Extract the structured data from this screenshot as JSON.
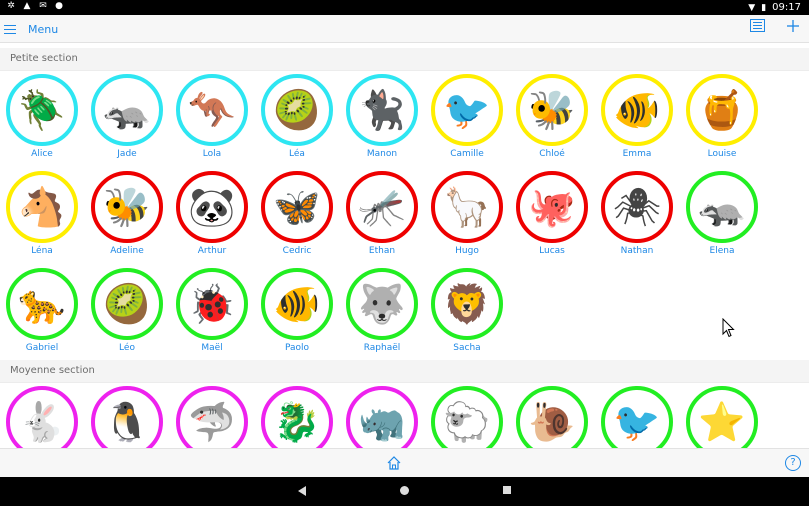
{
  "statusbar": {
    "time": "09:17",
    "left_icons": [
      "settings-icon",
      "drive-icon",
      "mail-icon",
      "record-icon"
    ]
  },
  "toolbar": {
    "menu_label": "Menu"
  },
  "colors": {
    "accent": "#1e88e5",
    "cyan": "#2ee6f2",
    "yellow": "#ffee00",
    "red": "#ee0000",
    "green": "#22ee22",
    "magenta": "#ee22ee"
  },
  "sections": [
    {
      "title": "Petite section",
      "children": [
        {
          "name": "Alice",
          "ring": "#2ee6f2",
          "emoji": "🪲"
        },
        {
          "name": "Jade",
          "ring": "#2ee6f2",
          "emoji": "🦡"
        },
        {
          "name": "Lola",
          "ring": "#2ee6f2",
          "emoji": "🦘"
        },
        {
          "name": "Léa",
          "ring": "#2ee6f2",
          "emoji": "🥝"
        },
        {
          "name": "Manon",
          "ring": "#2ee6f2",
          "emoji": "🐈‍⬛"
        },
        {
          "name": "Camille",
          "ring": "#ffee00",
          "emoji": "🐦"
        },
        {
          "name": "Chloé",
          "ring": "#ffee00",
          "emoji": "🐝"
        },
        {
          "name": "Emma",
          "ring": "#ffee00",
          "emoji": "🐠"
        },
        {
          "name": "Louise",
          "ring": "#ffee00",
          "emoji": "🍯"
        },
        {
          "name": "Léna",
          "ring": "#ffee00",
          "emoji": "🐴"
        },
        {
          "name": "Adeline",
          "ring": "#ee0000",
          "emoji": "🐝"
        },
        {
          "name": "Arthur",
          "ring": "#ee0000",
          "emoji": "🐼"
        },
        {
          "name": "Cedric",
          "ring": "#ee0000",
          "emoji": "🦋"
        },
        {
          "name": "Ethan",
          "ring": "#ee0000",
          "emoji": "🦟"
        },
        {
          "name": "Hugo",
          "ring": "#ee0000",
          "emoji": "🦙"
        },
        {
          "name": "Lucas",
          "ring": "#ee0000",
          "emoji": "🐙"
        },
        {
          "name": "Nathan",
          "ring": "#ee0000",
          "emoji": "🕷"
        },
        {
          "name": "Elena",
          "ring": "#22ee22",
          "emoji": "🦡"
        },
        {
          "name": "Gabriel",
          "ring": "#22ee22",
          "emoji": "🐆"
        },
        {
          "name": "Léo",
          "ring": "#22ee22",
          "emoji": "🥝"
        },
        {
          "name": "Maël",
          "ring": "#22ee22",
          "emoji": "🐞"
        },
        {
          "name": "Paolo",
          "ring": "#22ee22",
          "emoji": "🐠"
        },
        {
          "name": "Raphaël",
          "ring": "#22ee22",
          "emoji": "🐺"
        },
        {
          "name": "Sacha",
          "ring": "#22ee22",
          "emoji": "🦁"
        }
      ]
    },
    {
      "title": "Moyenne section",
      "children": [
        {
          "name": "",
          "ring": "#ee22ee",
          "emoji": "🐇"
        },
        {
          "name": "",
          "ring": "#ee22ee",
          "emoji": "🐧"
        },
        {
          "name": "",
          "ring": "#ee22ee",
          "emoji": "🦈"
        },
        {
          "name": "",
          "ring": "#ee22ee",
          "emoji": "🐉"
        },
        {
          "name": "",
          "ring": "#ee22ee",
          "emoji": "🦏"
        },
        {
          "name": "",
          "ring": "#22ee22",
          "emoji": "🐑"
        },
        {
          "name": "",
          "ring": "#22ee22",
          "emoji": "🐌"
        },
        {
          "name": "",
          "ring": "#22ee22",
          "emoji": "🐦"
        },
        {
          "name": "",
          "ring": "#22ee22",
          "emoji": "⭐"
        }
      ]
    }
  ]
}
